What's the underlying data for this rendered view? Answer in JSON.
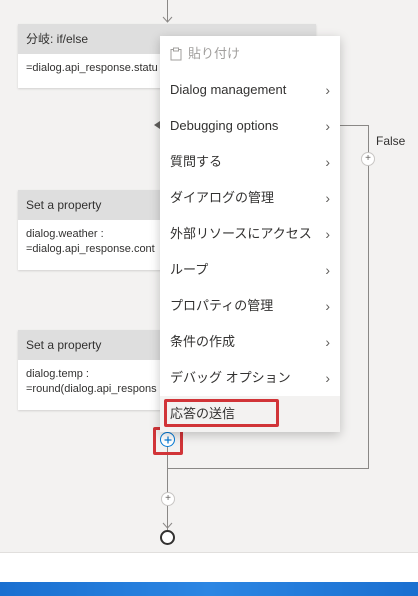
{
  "nodes": {
    "branch": {
      "title": "分岐: if/else",
      "body": "=dialog.api_response.statu"
    },
    "set_weather": {
      "title": "Set a property",
      "line1": "dialog.weather :",
      "line2": "=dialog.api_response.cont"
    },
    "set_temp": {
      "title": "Set a property",
      "line1": "dialog.temp :",
      "line2": "=round(dialog.api_respons"
    }
  },
  "false_label": "False",
  "context_menu": {
    "paste": "貼り付け",
    "items": [
      {
        "label": "Dialog management",
        "submenu": true
      },
      {
        "label": "Debugging options",
        "submenu": true
      },
      {
        "label": "質問する",
        "submenu": true
      },
      {
        "label": "ダイアログの管理",
        "submenu": true
      },
      {
        "label": "外部リソースにアクセス",
        "submenu": true
      },
      {
        "label": "ループ",
        "submenu": true
      },
      {
        "label": "プロパティの管理",
        "submenu": true
      },
      {
        "label": "条件の作成",
        "submenu": true
      },
      {
        "label": "デバッグ オプション",
        "submenu": true
      },
      {
        "label": "応答の送信",
        "submenu": false
      }
    ]
  },
  "icons": {
    "paste": "clipboard-icon",
    "chevron": "chevron-right-icon",
    "add": "plus-icon",
    "end": "end-circle-icon"
  },
  "colors": {
    "highlight": "#d13438",
    "accent": "#0078d4"
  }
}
